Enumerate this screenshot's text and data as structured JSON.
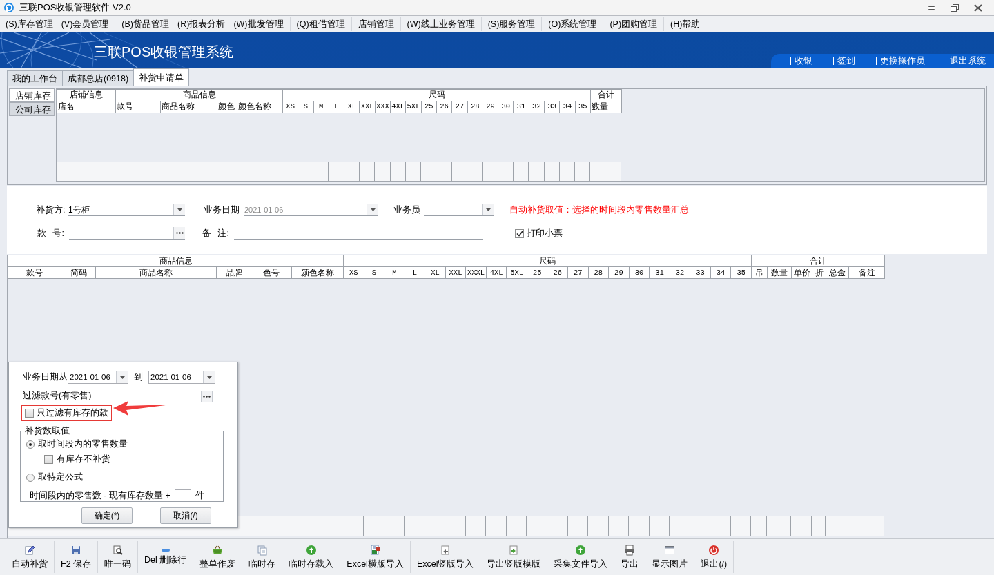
{
  "window": {
    "title": "三联POS收银管理软件 V2.0"
  },
  "menu": [
    {
      "key": "(S)",
      "label": "库存管理",
      "group_end": false
    },
    {
      "key": "(V)",
      "label": "会员管理",
      "group_end": true
    },
    {
      "key": "(B)",
      "label": "货品管理",
      "group_end": false
    },
    {
      "key": "(R)",
      "label": "报表分析",
      "group_end": false
    },
    {
      "key": "(W)",
      "label": "批发管理",
      "group_end": true
    },
    {
      "key": "(Q)",
      "label": "租借管理",
      "group_end": true
    },
    {
      "label": "店铺管理",
      "group_end": true
    },
    {
      "key": "(W)",
      "label": "线上业务管理",
      "group_end": true
    },
    {
      "key": "(S)",
      "label": "服务管理",
      "group_end": true
    },
    {
      "key": "(O)",
      "label": "系统管理",
      "group_end": true
    },
    {
      "key": "(P)",
      "label": "团购管理",
      "group_end": true
    },
    {
      "key": "(H)",
      "label": "帮助",
      "group_end": false
    }
  ],
  "banner": {
    "title": "三联POS收银管理系统",
    "links": [
      "收银",
      "签到",
      "更换操作员",
      "退出系统"
    ]
  },
  "tabs": [
    {
      "label": "我的工作台",
      "selected": false
    },
    {
      "label": "成都总店(0918)",
      "selected": false
    },
    {
      "label": "补货申请单",
      "selected": true
    }
  ],
  "stock_panel": {
    "side_tabs": [
      {
        "label": "店铺库存",
        "selected": true
      },
      {
        "label": "公司库存",
        "selected": false
      }
    ],
    "table": {
      "groups": [
        {
          "title": "店铺信息",
          "columns": [
            "店名"
          ]
        },
        {
          "title": "商品信息",
          "columns": [
            "款号",
            "商品名称",
            "颜色",
            "颜色名称"
          ]
        },
        {
          "title": "尺码",
          "columns": [
            "XS",
            "S",
            "M",
            "L",
            "XL",
            "XXL",
            "XXX",
            "4XL",
            "5XL",
            "25",
            "26",
            "27",
            "28",
            "29",
            "30",
            "31",
            "32",
            "33",
            "34",
            "35"
          ]
        },
        {
          "title": "合计",
          "columns": [
            "数量"
          ]
        }
      ]
    }
  },
  "form": {
    "supplier": {
      "label": "补货方:",
      "value": "1号柜"
    },
    "date": {
      "label": "业务日期",
      "value": "2021-01-06",
      "disabled": true
    },
    "clerk": {
      "label": "业务员"
    },
    "notice": "自动补货取值：选择的时间段内零售数量汇总",
    "style_no": {
      "label": "款 号:"
    },
    "remark": {
      "label": "备 注:"
    },
    "print_receipt": {
      "label": "打印小票",
      "checked": true
    }
  },
  "lines_table": {
    "groups": [
      {
        "title": "商品信息",
        "columns": [
          "款号",
          "简码",
          "商品名称",
          "品牌",
          "色号",
          "颜色名称"
        ]
      },
      {
        "title": "尺码",
        "columns": [
          "XS",
          "S",
          "M",
          "L",
          "XL",
          "XXL",
          "XXXL",
          "4XL",
          "5XL",
          "25",
          "26",
          "27",
          "28",
          "29",
          "30",
          "31",
          "32",
          "33",
          "34",
          "35"
        ]
      },
      {
        "title": "合计",
        "columns": [
          "吊",
          "数量",
          "单价",
          "折",
          "总金",
          "备注"
        ]
      }
    ]
  },
  "dialog": {
    "date_from": {
      "label": "业务日期从",
      "value": "2021-01-06"
    },
    "date_to": {
      "label": "到",
      "value": "2021-01-06"
    },
    "filter": {
      "label": "过滤款号(有零售)"
    },
    "only_in_stock": {
      "label": "只过滤有库存的款",
      "checked": false,
      "highlighted": true
    },
    "group": {
      "title": "补货数取值",
      "options": [
        {
          "label": "取时间段内的零售数量",
          "selected": true,
          "sub_option": {
            "label": "有库存不补货",
            "checked": false
          }
        },
        {
          "label": "取特定公式",
          "selected": false
        }
      ]
    },
    "formula": {
      "prefix": "时间段内的零售数 - 现有库存数量 +",
      "suffix": "件"
    },
    "buttons": [
      "确定(*)",
      "取消(/)"
    ]
  },
  "toolbar": [
    "自动补货",
    "F2 保存",
    "唯一码",
    "Del 删除行",
    "整单作废",
    "临时存",
    "临时存载入",
    "Excel横版导入",
    "Excel竖版导入",
    "导出竖版模版",
    "采集文件导入",
    "导出",
    "显示图片",
    "退出(/)"
  ]
}
